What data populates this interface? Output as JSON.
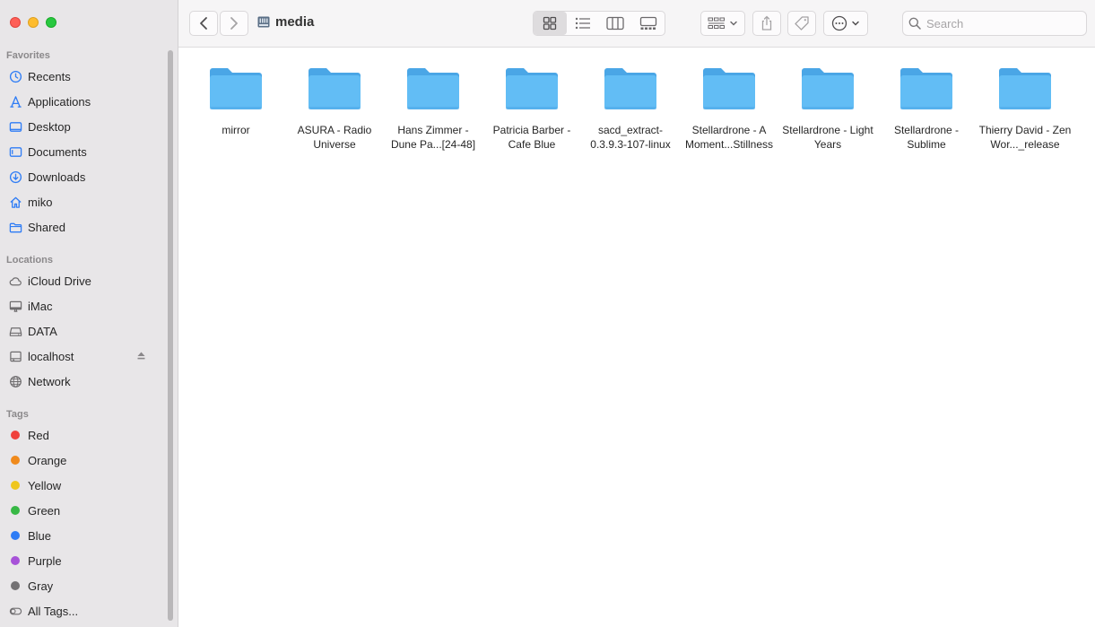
{
  "window": {
    "title": "media"
  },
  "sidebar": {
    "favorites_title": "Favorites",
    "favorites": [
      {
        "label": "Recents",
        "icon": "clock-icon"
      },
      {
        "label": "Applications",
        "icon": "applications-icon"
      },
      {
        "label": "Desktop",
        "icon": "desktop-icon"
      },
      {
        "label": "Documents",
        "icon": "document-icon"
      },
      {
        "label": "Downloads",
        "icon": "download-icon"
      },
      {
        "label": "miko",
        "icon": "home-icon"
      },
      {
        "label": "Shared",
        "icon": "shared-folder-icon"
      }
    ],
    "locations_title": "Locations",
    "locations": [
      {
        "label": "iCloud Drive",
        "icon": "cloud-icon"
      },
      {
        "label": "iMac",
        "icon": "imac-icon"
      },
      {
        "label": "DATA",
        "icon": "disk-icon"
      },
      {
        "label": "localhost",
        "icon": "server-icon"
      },
      {
        "label": "Network",
        "icon": "globe-icon"
      }
    ],
    "tags_title": "Tags",
    "tags": [
      {
        "label": "Red",
        "color": "#f0413b"
      },
      {
        "label": "Orange",
        "color": "#f08a1c"
      },
      {
        "label": "Yellow",
        "color": "#efc61c"
      },
      {
        "label": "Green",
        "color": "#37b845"
      },
      {
        "label": "Blue",
        "color": "#2e7cf5"
      },
      {
        "label": "Purple",
        "color": "#a752d8"
      },
      {
        "label": "Gray",
        "color": "#747274"
      },
      {
        "label": "All Tags...",
        "color": ""
      }
    ]
  },
  "toolbar": {
    "search_placeholder": "Search"
  },
  "folders": [
    {
      "label": "mirror"
    },
    {
      "label": "ASURA - Radio Universe"
    },
    {
      "label": "Hans Zimmer - Dune Pa...[24-48]"
    },
    {
      "label": "Patricia Barber - Cafe Blue"
    },
    {
      "label": "sacd_extract-0.3.9.3-107-linux"
    },
    {
      "label": "Stellardrone - A Moment...Stillness"
    },
    {
      "label": "Stellardrone - Light Years"
    },
    {
      "label": "Stellardrone - Sublime"
    },
    {
      "label": "Thierry David - Zen Wor..._release"
    }
  ],
  "colors": {
    "folder": "#62bdf5",
    "folder_dark": "#4aa6e6",
    "accent": "#2e7cf5"
  }
}
